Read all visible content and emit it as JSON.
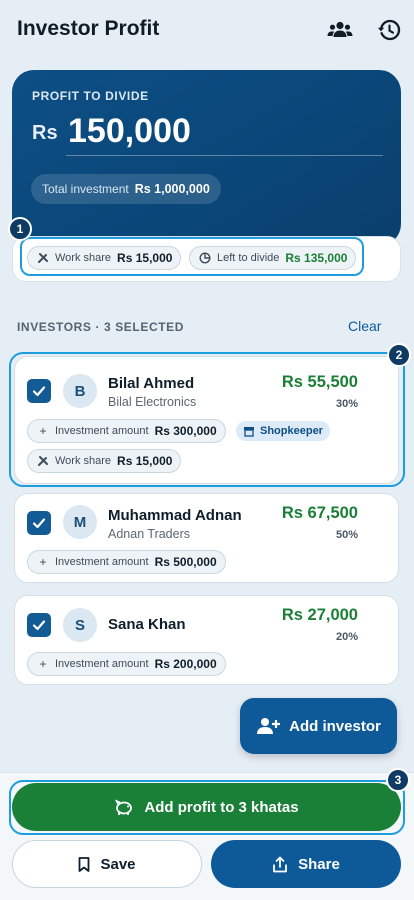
{
  "header": {
    "title": "Investor Profit",
    "icons": [
      "people-icon",
      "history-icon"
    ]
  },
  "summary": {
    "label": "PROFIT TO DIVIDE",
    "currency": "Rs",
    "amount": "150,000",
    "total_investment_label": "Total investment",
    "total_investment_value": "Rs 1,000,000"
  },
  "shares": {
    "badge": "1",
    "work_share_label": "Work share",
    "work_share_value": "Rs 15,000",
    "left_label": "Left to divide",
    "left_value": "Rs 135,000"
  },
  "investors_section": {
    "title": "INVESTORS · 3 SELECTED",
    "clear_label": "Clear",
    "badge": "2"
  },
  "investors": [
    {
      "initial": "B",
      "name": "Bilal Ahmed",
      "business": "Bilal Electronics",
      "amount": "Rs 55,500",
      "percent": "30%",
      "investment_label": "Investment amount",
      "investment_value": "Rs 300,000",
      "tag": "Shopkeeper",
      "work_share_label": "Work share",
      "work_share_value": "Rs 15,000"
    },
    {
      "initial": "M",
      "name": "Muhammad Adnan",
      "business": "Adnan Traders",
      "amount": "Rs 67,500",
      "percent": "50%",
      "investment_label": "Investment amount",
      "investment_value": "Rs 500,000"
    },
    {
      "initial": "S",
      "name": "Sana Khan",
      "amount": "Rs 27,000",
      "percent": "20%",
      "investment_label": "Investment amount",
      "investment_value": "Rs 200,000"
    }
  ],
  "add_investor_label": "Add investor",
  "actions": {
    "badge": "3",
    "primary_label": "Add profit to 3 khatas",
    "save_label": "Save",
    "share_label": "Share"
  },
  "colors": {
    "primary": "#0e5a99",
    "hero": "#0a4678",
    "success": "#1a7f37",
    "highlight": "#1e9ce0",
    "background": "#e6eef5"
  }
}
